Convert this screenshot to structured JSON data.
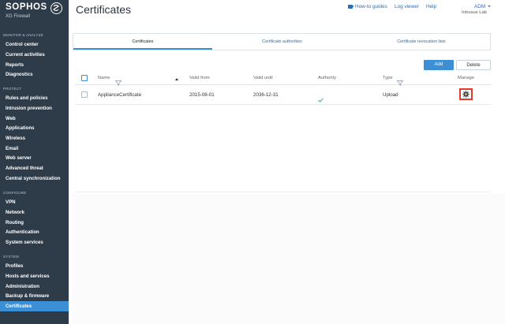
{
  "brand": {
    "name": "SOPHOS",
    "product": "XG Firewall"
  },
  "sidebar": {
    "sections": [
      {
        "label": "MONITOR & ANALYZE"
      },
      {
        "label": "PROTECT"
      },
      {
        "label": "CONFIGURE"
      },
      {
        "label": "SYSTEM"
      }
    ],
    "items": [
      {
        "label": "Control center"
      },
      {
        "label": "Current activities"
      },
      {
        "label": "Reports"
      },
      {
        "label": "Diagnostics"
      },
      {
        "label": "Rules and policies"
      },
      {
        "label": "Intrusion prevention"
      },
      {
        "label": "Web"
      },
      {
        "label": "Applications"
      },
      {
        "label": "Wireless"
      },
      {
        "label": "Email"
      },
      {
        "label": "Web server"
      },
      {
        "label": "Advanced threat"
      },
      {
        "label": "Central synchronization"
      },
      {
        "label": "VPN"
      },
      {
        "label": "Network"
      },
      {
        "label": "Routing"
      },
      {
        "label": "Authentication"
      },
      {
        "label": "System services"
      },
      {
        "label": "Profiles"
      },
      {
        "label": "Hosts and services"
      },
      {
        "label": "Administration"
      },
      {
        "label": "Backup & firmware"
      },
      {
        "label": "Certificates",
        "active": true
      }
    ]
  },
  "header": {
    "title": "Certificates",
    "how_to_guides": "How-to guides",
    "log_viewer": "Log viewer",
    "help": "Help",
    "user": "ADM",
    "org": "Intrusus Lab"
  },
  "tabs": [
    {
      "label": "Certificates",
      "active": true
    },
    {
      "label": "Certificate authorities"
    },
    {
      "label": "Certificate revocation lists"
    }
  ],
  "toolbar": {
    "add_label": "Add",
    "delete_label": "Delete"
  },
  "table": {
    "columns": [
      "Name",
      "Valid from",
      "Valid until",
      "Authority",
      "Type",
      "Manage"
    ],
    "rows": [
      {
        "name": "ApplianceCertificate",
        "valid_from": "2015-08-01",
        "valid_until": "2036-12-31",
        "authority": "check-icon",
        "type": "Upload",
        "manage": "gear-icon"
      }
    ]
  },
  "colors": {
    "sidebar_bg": "#2e3b49",
    "accent": "#3c8fd5",
    "link": "#2a6fb6",
    "highlight_box": "#e23b2e",
    "check": "#3daa6f"
  }
}
